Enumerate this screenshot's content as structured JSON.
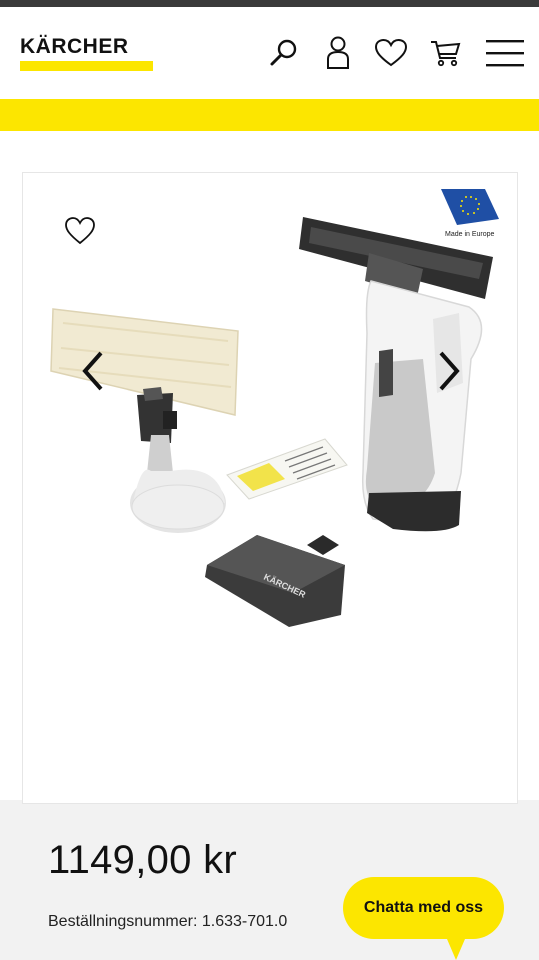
{
  "brand": {
    "name": "KÄRCHER",
    "accent": "#fce600"
  },
  "header": {
    "icons": [
      "search-icon",
      "user-icon",
      "heart-icon",
      "cart-icon",
      "menu-icon"
    ]
  },
  "product": {
    "badge": {
      "text": "Made in Europe",
      "icon": "eu-flag-icon"
    },
    "price": "1149,00 kr",
    "order_number": "Beställningsnummer: 1.633-701.0"
  },
  "chat": {
    "label": "Chatta med oss"
  }
}
